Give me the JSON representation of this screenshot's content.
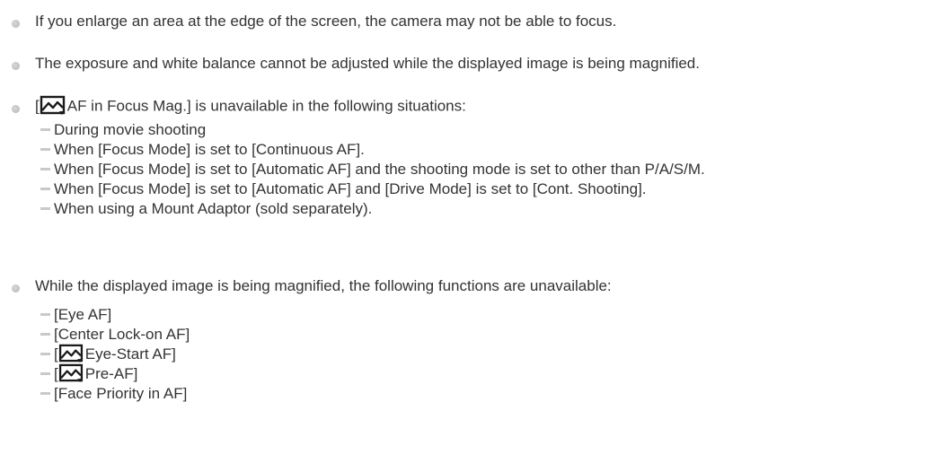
{
  "bullets": [
    {
      "text": "If you enlarge an area at the edge of the screen, the camera may not be able to focus."
    },
    {
      "text": "The exposure and white balance cannot be adjusted while the displayed image is being magnified."
    },
    {
      "prefix": "[",
      "icon": "still-image-icon",
      "text": "AF in Focus Mag.] is unavailable in the following situations:",
      "sub": [
        "During movie shooting",
        "When [Focus Mode] is set to [Continuous AF].",
        "When [Focus Mode] is set to [Automatic AF] and the shooting mode is set to other than P/A/S/M.",
        "When [Focus Mode] is set to [Automatic AF] and [Drive Mode] is set to [Cont. Shooting].",
        "When using a Mount Adaptor (sold separately)."
      ]
    },
    {
      "text": "While the displayed image is being magnified, the following functions are unavailable:",
      "sub": [
        {
          "text": "[Eye AF]"
        },
        {
          "text": "[Center Lock-on AF]"
        },
        {
          "prefix": "[",
          "icon": "still-image-icon",
          "text": "Eye-Start AF]"
        },
        {
          "prefix": "[",
          "icon": "still-image-icon",
          "text": "Pre-AF]"
        },
        {
          "text": "[Face Priority in AF]"
        }
      ]
    }
  ],
  "colors": {
    "text": "#333333",
    "bullet": "#c4c4c4",
    "dash": "#c9c9c9",
    "icon_stroke": "#1a1a1a"
  }
}
